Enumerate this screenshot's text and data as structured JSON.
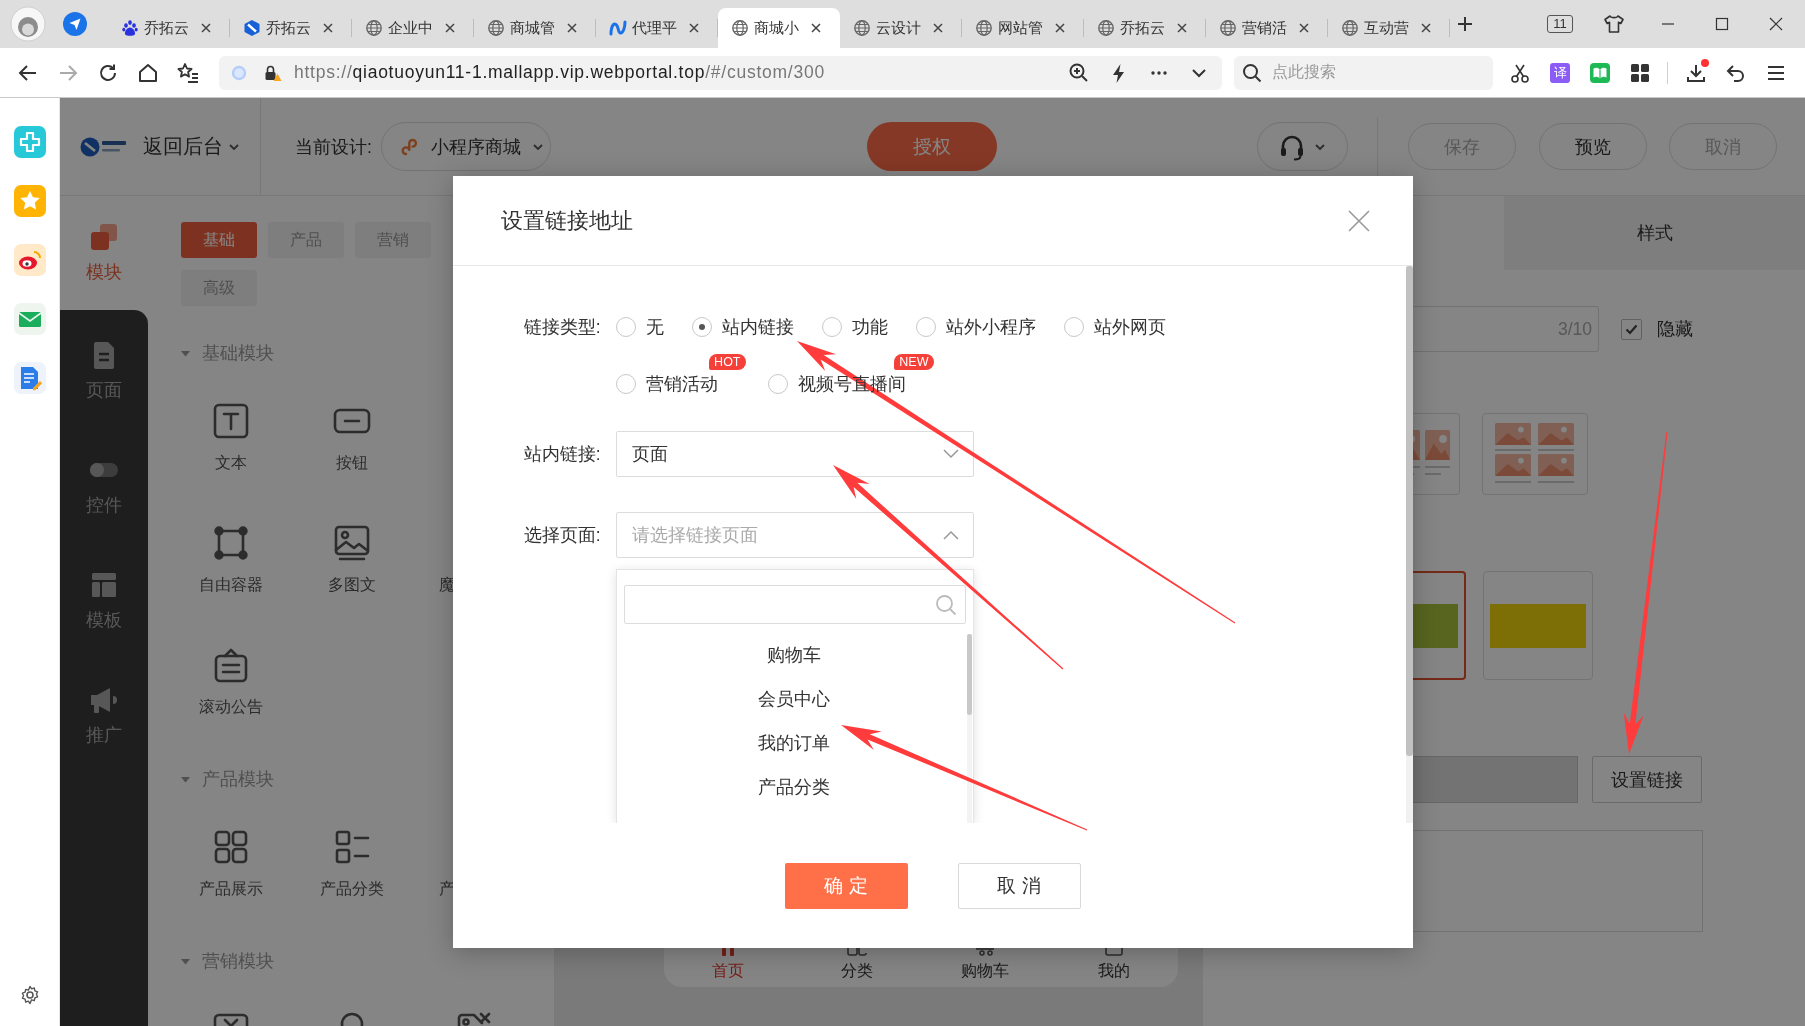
{
  "browser": {
    "tabs": [
      {
        "title": "乔拓云",
        "selected": false
      },
      {
        "title": "乔拓云",
        "selected": false
      },
      {
        "title": "企业中",
        "selected": false
      },
      {
        "title": "商城管",
        "selected": false
      },
      {
        "title": "代理平",
        "selected": false
      },
      {
        "title": "商城小",
        "selected": true
      },
      {
        "title": "云设计",
        "selected": false
      },
      {
        "title": "网站管",
        "selected": false
      },
      {
        "title": "乔拓云",
        "selected": false
      },
      {
        "title": "营销活",
        "selected": false
      },
      {
        "title": "互动营",
        "selected": false
      }
    ],
    "tab_count": "11",
    "address": {
      "scheme": "https://",
      "host": "qiaotuoyun11-1.mallapp.vip.webportal.top",
      "path": "/#/custom/300"
    },
    "search": {
      "placeholder": "点此搜索"
    },
    "translate_label": "译"
  },
  "header": {
    "back_label": "返回后台",
    "design_label": "当前设计:",
    "design_name": "小程序商城",
    "authorize": "授权",
    "actions": [
      {
        "label": "保存",
        "disabled": true
      },
      {
        "label": "预览",
        "disabled": false
      },
      {
        "label": "取消",
        "disabled": true
      }
    ]
  },
  "sidebar": {
    "items": [
      {
        "label": "模块",
        "selected": true
      },
      {
        "label": "页面",
        "selected": false
      },
      {
        "label": "控件",
        "selected": false
      },
      {
        "label": "模板",
        "selected": false
      },
      {
        "label": "推广",
        "selected": false
      }
    ]
  },
  "module_panel": {
    "tabs": [
      {
        "label": "基础",
        "selected": true
      },
      {
        "label": "产品",
        "selected": false
      },
      {
        "label": "营销",
        "selected": false
      },
      {
        "label": "高级",
        "selected": false
      }
    ],
    "sections": [
      {
        "title": "基础模块",
        "expanded": true,
        "rows": [
          [
            {
              "kind": "tile",
              "label": "文本"
            },
            {
              "kind": "tile",
              "label": "按钮"
            }
          ],
          [
            {
              "kind": "tile",
              "label": "自由容器"
            },
            {
              "kind": "tile",
              "label": "多图文"
            },
            {
              "kind": "edge",
              "label": "魔"
            }
          ],
          [
            {
              "kind": "tile",
              "label": "滚动公告"
            }
          ]
        ]
      },
      {
        "title": "产品模块",
        "expanded": true,
        "rows": [
          [
            {
              "kind": "tile",
              "label": "产品展示"
            },
            {
              "kind": "tile",
              "label": "产品分类"
            },
            {
              "kind": "edge",
              "label": "产"
            }
          ]
        ]
      },
      {
        "title": "营销模块",
        "expanded": true,
        "rows": [
          [
            {
              "kind": "peek"
            },
            {
              "kind": "peek"
            },
            {
              "kind": "peek"
            }
          ]
        ]
      }
    ]
  },
  "canvas": {
    "tab_bar": [
      {
        "label": "首页",
        "selected": true
      },
      {
        "label": "分类",
        "selected": false
      },
      {
        "label": "购物车",
        "selected": false
      },
      {
        "label": "我的",
        "selected": false
      }
    ]
  },
  "settings_panel": {
    "tab": {
      "label": "样式",
      "selected": false
    },
    "title_field": {
      "counter": "3/10"
    },
    "hide_option": {
      "label": "隐藏",
      "checked": true
    },
    "layouts": [
      {
        "selected": false
      },
      {
        "selected": false
      }
    ],
    "images": [
      {
        "selected": true
      },
      {
        "selected": false
      }
    ],
    "link_field": {
      "disabled": true
    },
    "link_button": "设置链接",
    "description_field": {
      "disabled": false
    }
  },
  "dialog": {
    "title": "设置链接地址",
    "link_type": {
      "label": "链接类型:",
      "options": [
        {
          "label": "无",
          "selected": false
        },
        {
          "label": "站内链接",
          "selected": true
        },
        {
          "label": "功能",
          "selected": false
        },
        {
          "label": "站外小程序",
          "selected": false
        },
        {
          "label": "站外网页",
          "selected": false
        },
        {
          "label": "营销活动",
          "selected": false,
          "badge": "HOT"
        },
        {
          "label": "视频号直播间",
          "selected": false,
          "badge": "NEW"
        }
      ]
    },
    "internal_link": {
      "label": "站内链接:",
      "value": "页面",
      "expanded": false
    },
    "page_select": {
      "label": "选择页面:",
      "placeholder": "请选择链接页面",
      "expanded": true,
      "options": [
        "购物车",
        "会员中心",
        "我的订单",
        "产品分类"
      ]
    },
    "buttons": [
      {
        "label": "确 定",
        "kind": "primary"
      },
      {
        "label": "取 消",
        "kind": "default"
      }
    ]
  },
  "annotation_arrows": [
    {
      "kind": "arrow"
    },
    {
      "kind": "arrow"
    },
    {
      "kind": "arrow"
    },
    {
      "kind": "arrow"
    }
  ]
}
